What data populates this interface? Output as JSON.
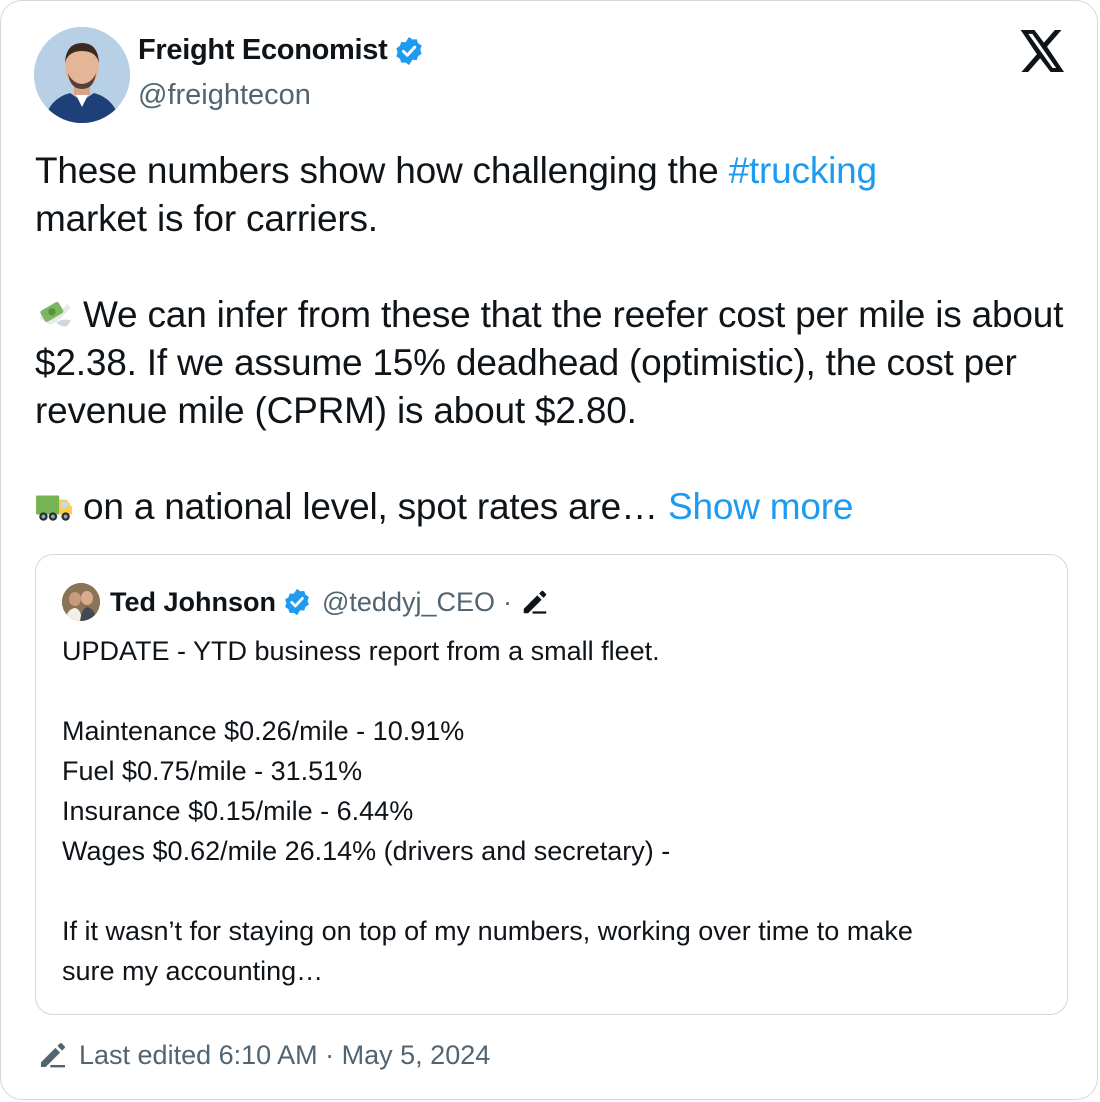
{
  "author": {
    "name": "Freight Economist",
    "handle": "@freightecon",
    "verified": true
  },
  "tweet": {
    "line1_before": "These numbers show how challenging the ",
    "hashtag": "#trucking",
    "line1_after": "market is for carriers.",
    "para2": "We can infer from these that the reefer cost per mile is about $2.38. If we assume 15% deadhead (optimistic), the cost per revenue mile (CPRM) is about $2.80.",
    "para3": "on a national level, spot rates are…",
    "show_more": "Show more",
    "emoji_money": "money-with-wings-icon",
    "emoji_truck": "truck-icon"
  },
  "quote": {
    "name": "Ted Johnson",
    "handle": "@teddyj_CEO",
    "separator": "·",
    "verified": true,
    "lines": [
      "UPDATE - YTD business report from a small fleet.",
      "",
      "Maintenance $0.26/mile - 10.91%",
      "Fuel $0.75/mile - 31.51%",
      "Insurance $0.15/mile - 6.44%",
      "Wages $0.62/mile 26.14% (drivers and secretary) -",
      "",
      "If it wasn’t for staying on top of my numbers, working over time to make",
      "sure my accounting…"
    ]
  },
  "footer": {
    "text": "Last edited 6:10 AM · May 5, 2024"
  },
  "colors": {
    "link": "#1d9bf0",
    "muted": "#536471",
    "border": "#cfd9de",
    "text": "#0f1419"
  }
}
